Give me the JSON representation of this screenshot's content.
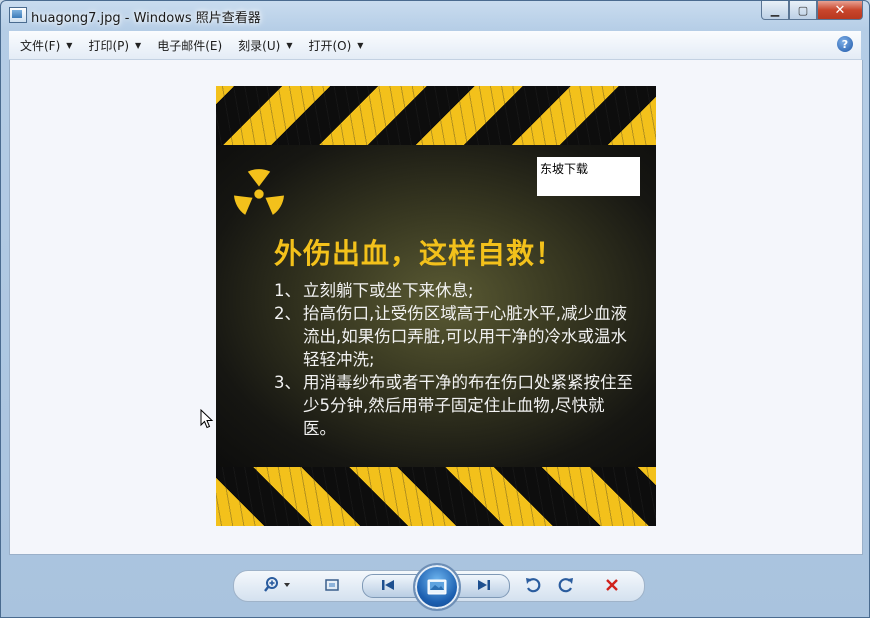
{
  "window": {
    "title": "huagong7.jpg - Windows 照片查看器",
    "minimize_glyph": "▁",
    "maximize_glyph": "▢",
    "close_glyph": "✕"
  },
  "menu": {
    "items": [
      {
        "label": "文件(F)",
        "has_dropdown": true
      },
      {
        "label": "打印(P)",
        "has_dropdown": true
      },
      {
        "label": "电子邮件(E)",
        "has_dropdown": false
      },
      {
        "label": "刻录(U)",
        "has_dropdown": true
      },
      {
        "label": "打开(O)",
        "has_dropdown": true
      }
    ],
    "help_glyph": "?"
  },
  "photo": {
    "watermark": "东坡下载",
    "title": "外伤出血，这样自救！",
    "steps": [
      {
        "num": "1、",
        "text": "立刻躺下或坐下来休息;"
      },
      {
        "num": "2、",
        "text": "抬高伤口,让受伤区域高于心脏水平,减少血液流出,如果伤口弄脏,可以用干净的冷水或温水轻轻冲洗;"
      },
      {
        "num": "3、",
        "text": "用消毒纱布或者干净的布在伤口处紧紧按住至少5分钟,然后用带子固定住止血物,尽快就医。"
      }
    ],
    "colors": {
      "accent": "#f3c11b",
      "dark": "#0d0d0d",
      "text": "#f2f2f2"
    }
  },
  "toolbar": {
    "icons": [
      "zoom-icon",
      "actual-size-icon",
      "previous-icon",
      "slideshow-icon",
      "next-icon",
      "rotate-counterclockwise-icon",
      "rotate-clockwise-icon",
      "delete-icon"
    ]
  }
}
